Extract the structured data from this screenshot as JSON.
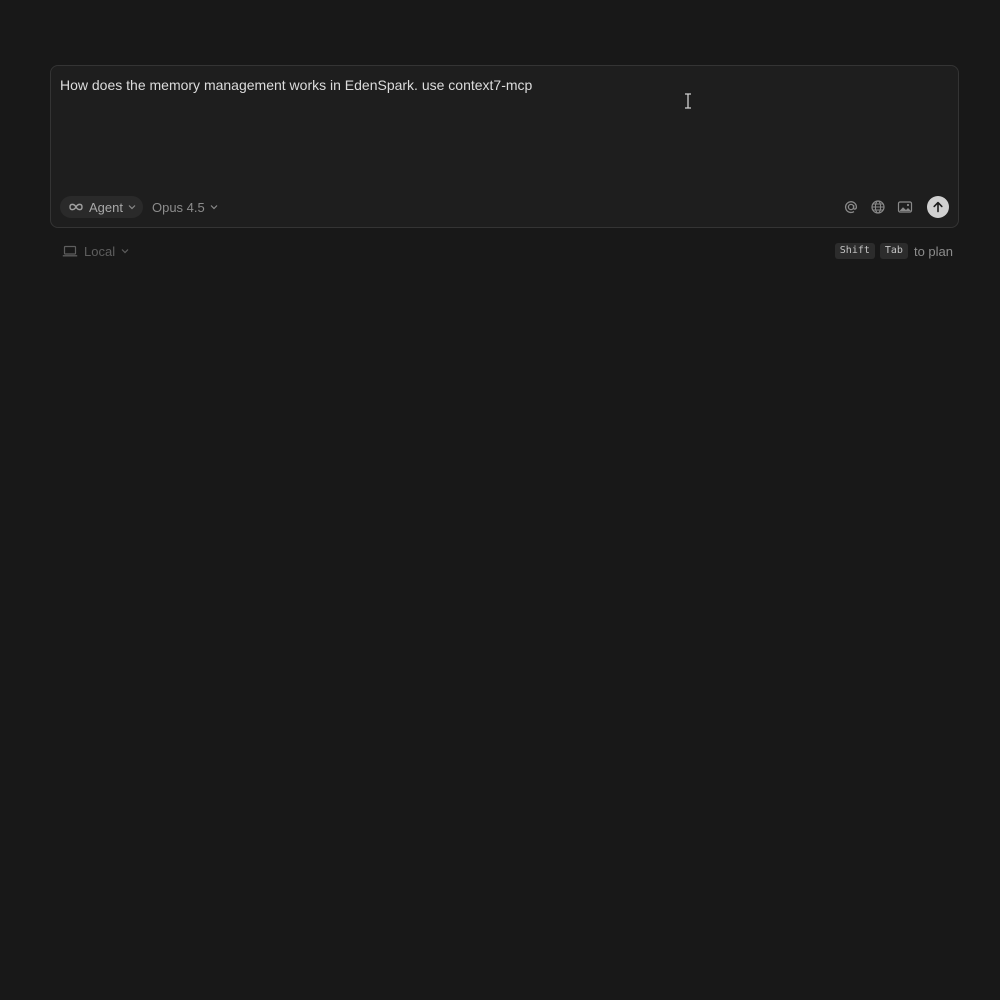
{
  "composer": {
    "prompt_text": "How does the memory management works in EdenSpark. use context7-mcp",
    "mode_label": "Agent",
    "mode_icon": "infinity-icon",
    "model_label": "Opus 4.5",
    "tools": [
      "at-mention-icon",
      "globe-icon",
      "image-icon"
    ],
    "send_icon": "arrow-up-icon"
  },
  "footer": {
    "environment_label": "Local",
    "environment_icon": "laptop-icon",
    "shortcut_keys": [
      "Shift",
      "Tab"
    ],
    "shortcut_hint": "to plan"
  },
  "colors": {
    "background": "#181818",
    "composer_background": "#1e1e1e",
    "send_button": "#d0d0d0"
  }
}
